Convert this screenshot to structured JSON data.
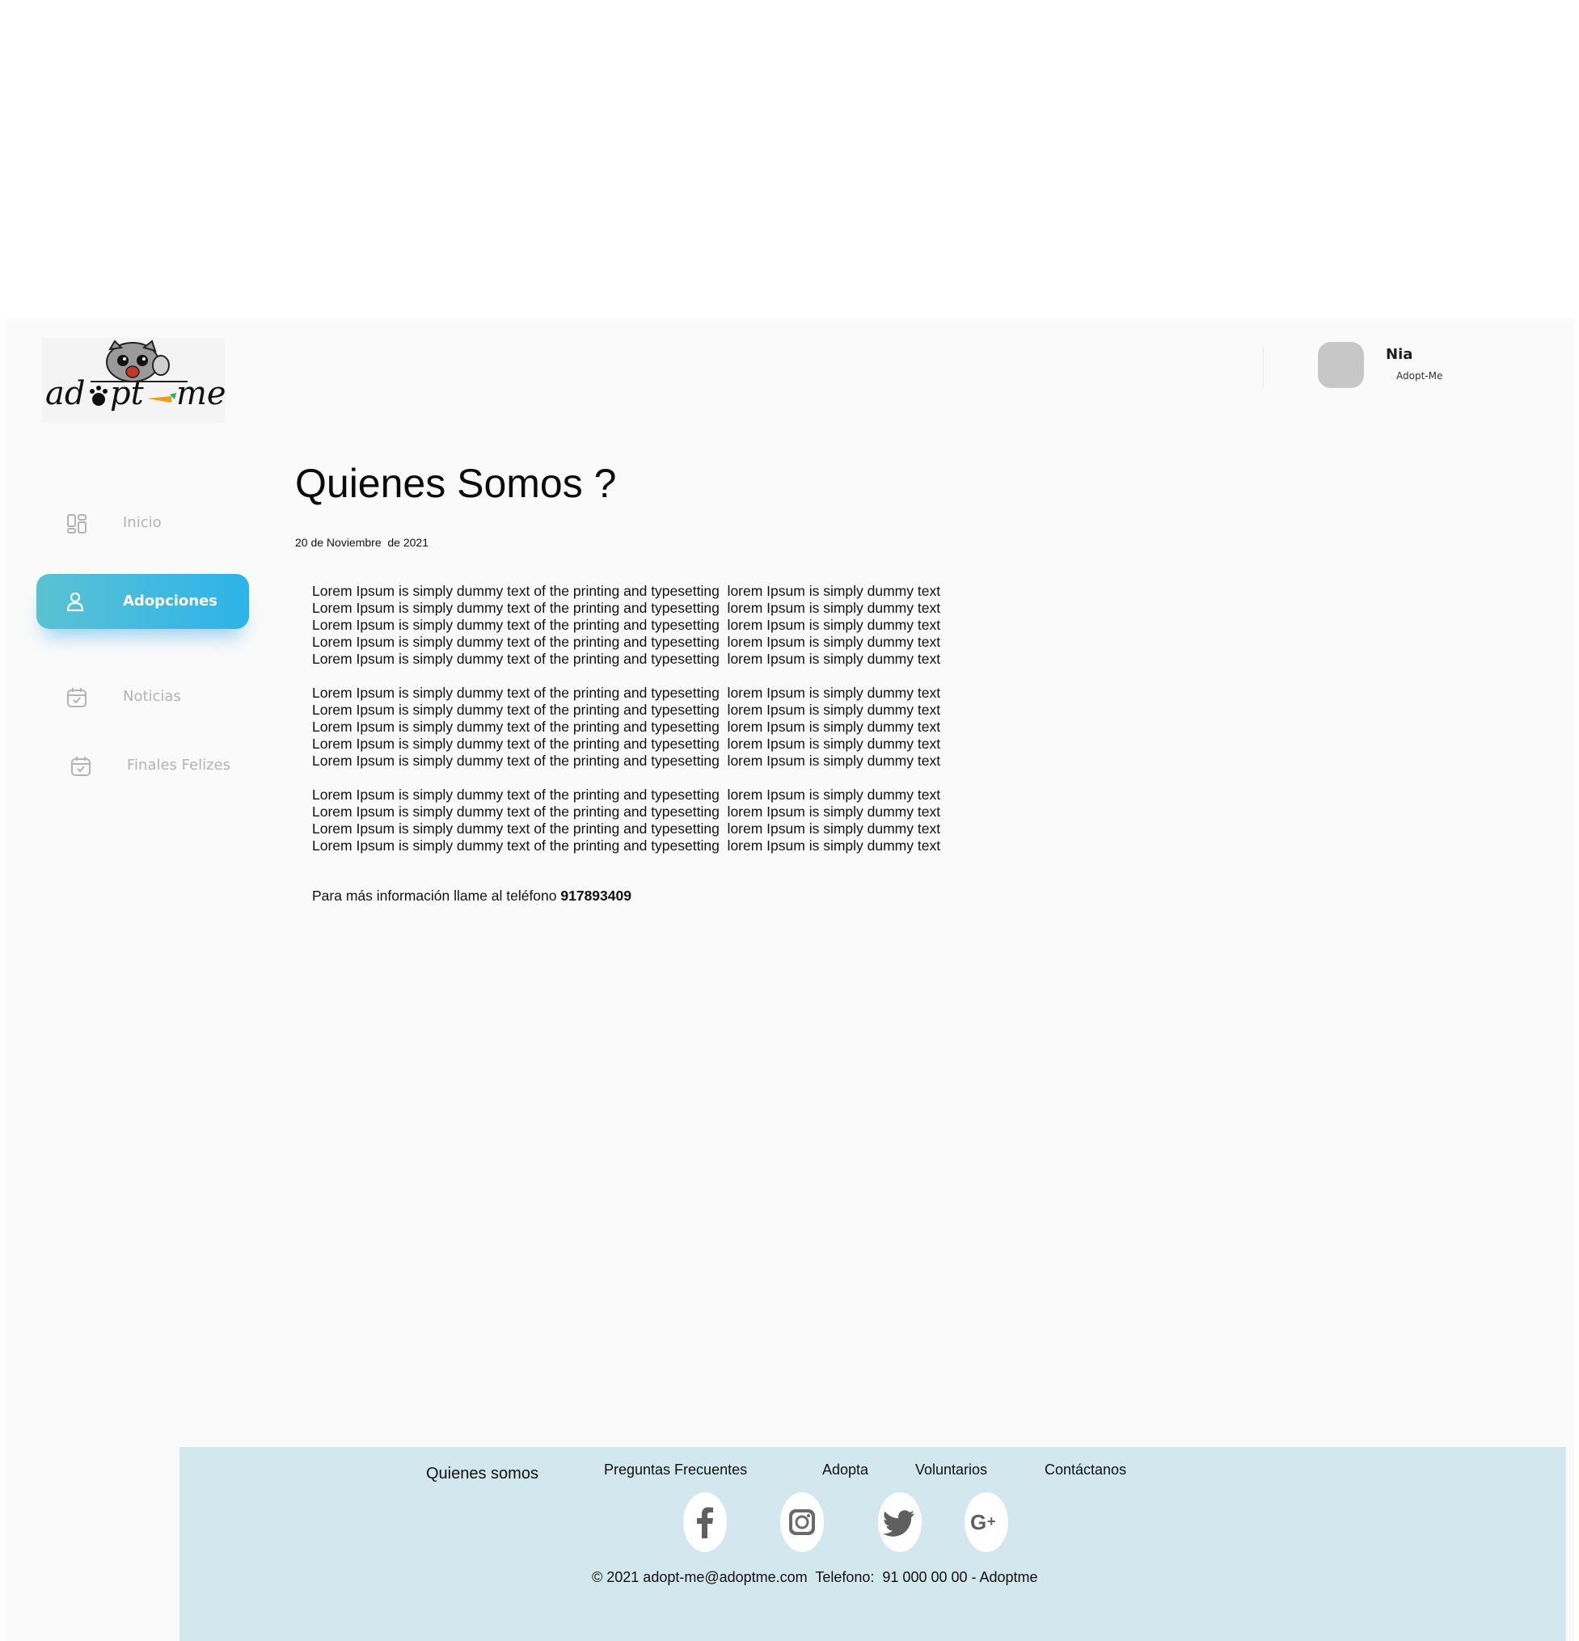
{
  "brand": {
    "logo_text": "adopt-me",
    "accent_color": "#2db3ea",
    "footer_color": "#d3e8ee"
  },
  "user": {
    "name": "Nia",
    "org": "Adopt-Me"
  },
  "sidebar": {
    "active_index": 1,
    "items": [
      {
        "label": "Inicio",
        "icon": "dashboard-icon"
      },
      {
        "label": "Adopciones",
        "icon": "user-icon"
      },
      {
        "label": "Noticias",
        "icon": "calendar-check-icon"
      },
      {
        "label": "Finales Felizes",
        "icon": "calendar-check-icon"
      }
    ]
  },
  "main": {
    "title": "Quienes Somos ?",
    "date": "20 de Noviembre  de 2021",
    "paragraphs": [
      [
        "Lorem Ipsum is simply dummy text of the printing and typesetting  lorem Ipsum is simply dummy text",
        "Lorem Ipsum is simply dummy text of the printing and typesetting  lorem Ipsum is simply dummy text",
        "Lorem Ipsum is simply dummy text of the printing and typesetting  lorem Ipsum is simply dummy text",
        "Lorem Ipsum is simply dummy text of the printing and typesetting  lorem Ipsum is simply dummy text",
        "Lorem Ipsum is simply dummy text of the printing and typesetting  lorem Ipsum is simply dummy text"
      ],
      [
        "Lorem Ipsum is simply dummy text of the printing and typesetting  lorem Ipsum is simply dummy text",
        "Lorem Ipsum is simply dummy text of the printing and typesetting  lorem Ipsum is simply dummy text",
        "Lorem Ipsum is simply dummy text of the printing and typesetting  lorem Ipsum is simply dummy text",
        "Lorem Ipsum is simply dummy text of the printing and typesetting  lorem Ipsum is simply dummy text",
        "Lorem Ipsum is simply dummy text of the printing and typesetting  lorem Ipsum is simply dummy text"
      ],
      [
        "Lorem Ipsum is simply dummy text of the printing and typesetting  lorem Ipsum is simply dummy text",
        "Lorem Ipsum is simply dummy text of the printing and typesetting  lorem Ipsum is simply dummy text",
        "Lorem Ipsum is simply dummy text of the printing and typesetting  lorem Ipsum is simply dummy text",
        "Lorem Ipsum is simply dummy text of the printing and typesetting  lorem Ipsum is simply dummy text"
      ]
    ],
    "contact_prefix": "Para más información llame al teléfono ",
    "contact_phone": "917893409"
  },
  "footer": {
    "links": [
      "Quienes somos",
      "Preguntas Frecuentes",
      "Adopta",
      "Voluntarios",
      "Contáctanos"
    ],
    "social": [
      "facebook-icon",
      "instagram-icon",
      "twitter-icon",
      "google-plus-icon"
    ],
    "copyright": "© 2021 adopt-me@adoptme.com  Telefono:  91 000 00 00 - Adoptme"
  }
}
